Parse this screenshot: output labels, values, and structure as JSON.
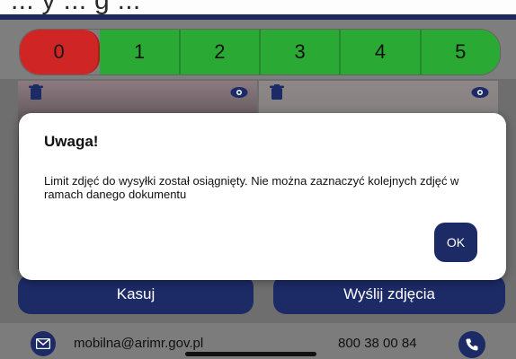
{
  "header": {
    "title_partial": "... y ... g ...",
    "segments": [
      {
        "label": "0",
        "active": true
      },
      {
        "label": "1",
        "active": false
      },
      {
        "label": "2",
        "active": false
      },
      {
        "label": "3",
        "active": false
      },
      {
        "label": "4",
        "active": false
      },
      {
        "label": "5",
        "active": false
      }
    ]
  },
  "colors": {
    "active_segment": "#cf2525",
    "segment": "#2aa935",
    "primary_button": "#1c2a66"
  },
  "tiles": [
    {
      "delete_icon": "trash-icon",
      "preview_icon": "eye-icon"
    },
    {
      "delete_icon": "trash-icon",
      "preview_icon": "eye-icon"
    }
  ],
  "actions": {
    "delete_label": "Kasuj",
    "send_label": "Wyślij zdjęcia"
  },
  "footer": {
    "email": "mobilna@arimr.gov.pl",
    "phone": "800 38 00 84",
    "email_icon": "mail-icon",
    "phone_icon": "phone-icon"
  },
  "dialog": {
    "title": "Uwaga!",
    "message": "Limit zdjęć do wysyłki został osiągnięty. Nie można zaznaczyć kolejnych zdjęć w ramach danego dokumentu",
    "ok_label": "OK"
  }
}
